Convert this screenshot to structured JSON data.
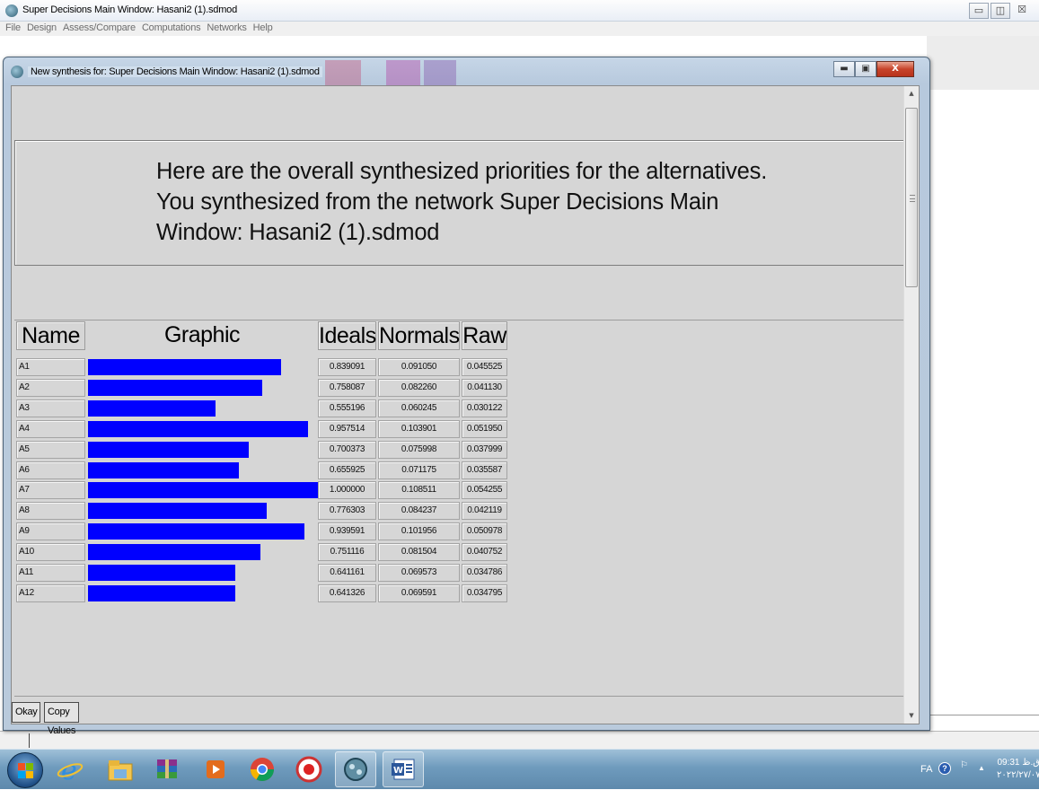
{
  "app": {
    "title": "Super Decisions Main Window: Hasani2 (1).sdmod",
    "controls": {
      "minimize": "▭",
      "maximize": "◫",
      "close": "☒"
    }
  },
  "menu": [
    "File",
    "Design",
    "Assess/Compare",
    "Computations",
    "Networks",
    "Help"
  ],
  "window": {
    "title": "New synthesis for: Super Decisions Main Window: Hasani2 (1).sdmod",
    "controls": {
      "minimize": "▬",
      "maximize": "▣",
      "close": "X"
    }
  },
  "message": {
    "line1": "Here are the overall synthesized priorities for the alternatives.",
    "line2": "You synthesized from the network Super Decisions Main",
    "line3": "Window: Hasani2 (1).sdmod"
  },
  "table": {
    "headers": {
      "name": "Name",
      "graphic": "Graphic",
      "ideals": "Ideals",
      "normals": "Normals",
      "raw": "Raw"
    },
    "rows": [
      {
        "name": "A1",
        "ideal": "0.839091",
        "normal": "0.091050",
        "raw": "0.045525",
        "bar": 0.839091
      },
      {
        "name": "A2",
        "ideal": "0.758087",
        "normal": "0.082260",
        "raw": "0.041130",
        "bar": 0.758087
      },
      {
        "name": "A3",
        "ideal": "0.555196",
        "normal": "0.060245",
        "raw": "0.030122",
        "bar": 0.555196
      },
      {
        "name": "A4",
        "ideal": "0.957514",
        "normal": "0.103901",
        "raw": "0.051950",
        "bar": 0.957514
      },
      {
        "name": "A5",
        "ideal": "0.700373",
        "normal": "0.075998",
        "raw": "0.037999",
        "bar": 0.700373
      },
      {
        "name": "A6",
        "ideal": "0.655925",
        "normal": "0.071175",
        "raw": "0.035587",
        "bar": 0.655925
      },
      {
        "name": "A7",
        "ideal": "1.000000",
        "normal": "0.108511",
        "raw": "0.054255",
        "bar": 1.0
      },
      {
        "name": "A8",
        "ideal": "0.776303",
        "normal": "0.084237",
        "raw": "0.042119",
        "bar": 0.776303
      },
      {
        "name": "A9",
        "ideal": "0.939591",
        "normal": "0.101956",
        "raw": "0.050978",
        "bar": 0.939591
      },
      {
        "name": "A10",
        "ideal": "0.751116",
        "normal": "0.081504",
        "raw": "0.040752",
        "bar": 0.751116
      },
      {
        "name": "A11",
        "ideal": "0.641161",
        "normal": "0.069573",
        "raw": "0.034786",
        "bar": 0.641161
      },
      {
        "name": "A12",
        "ideal": "0.641326",
        "normal": "0.069591",
        "raw": "0.034795",
        "bar": 0.641326
      }
    ],
    "bar_color": "#0000ff"
  },
  "buttons": {
    "okay": "Okay",
    "copy": "Copy Values"
  },
  "taskbar": {
    "apps": [
      "start-button",
      "internet-explorer",
      "file-explorer",
      "winrar",
      "media-player",
      "chrome",
      "recorder",
      "super-decisions",
      "word"
    ],
    "tray": {
      "lang": "FA",
      "help": "?",
      "time": "09:31 ق.ظ",
      "date": "۲۰۲۲/۲۷/۰۷"
    }
  }
}
